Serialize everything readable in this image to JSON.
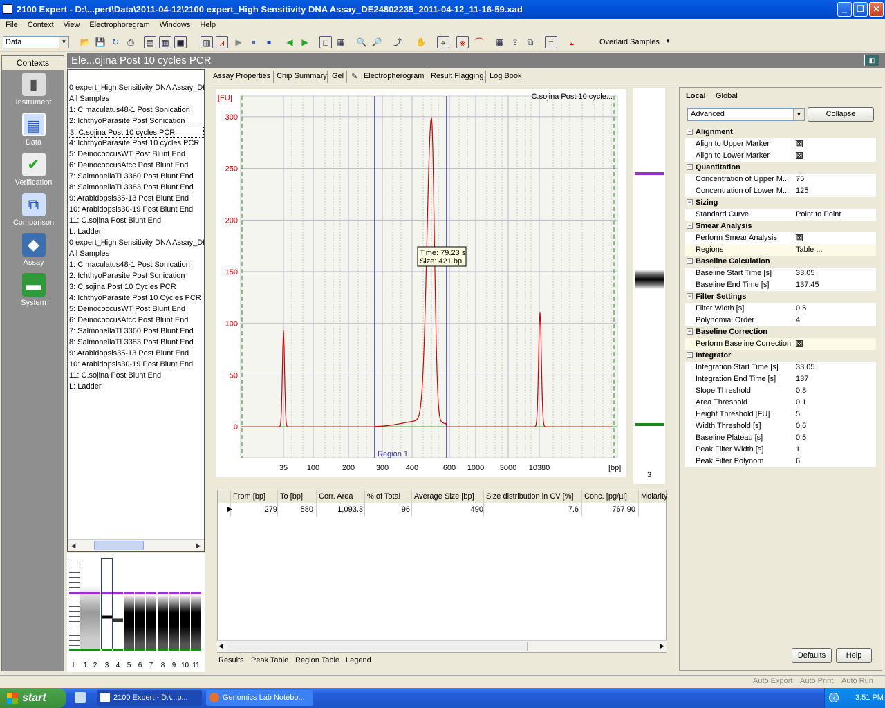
{
  "window": {
    "title": "2100 Expert - D:\\...pert\\Data\\2011-04-12\\2100 expert_High Sensitivity DNA Assay_DE24802235_2011-04-12_11-16-59.xad",
    "minimize": "_",
    "maximize": "❐",
    "close": "✕"
  },
  "menu": [
    "File",
    "Context",
    "View",
    "Electrophoregram",
    "Windows",
    "Help"
  ],
  "toolbar": {
    "context_select": "Data",
    "overlaid_select": "Overlaid Samples"
  },
  "contexts": {
    "header": "Contexts",
    "items": [
      {
        "label": "Instrument",
        "icon": "instrument-icon"
      },
      {
        "label": "Data",
        "icon": "data-icon"
      },
      {
        "label": "Verification",
        "icon": "verification-icon"
      },
      {
        "label": "Comparison",
        "icon": "comparison-icon"
      },
      {
        "label": "Assay",
        "icon": "assay-icon"
      },
      {
        "label": "System",
        "icon": "system-icon"
      }
    ]
  },
  "page_title": "Ele...ojina Post 10 cycles PCR",
  "sample_list": [
    "0 expert_High Sensitivity DNA Assay_DE",
    "All Samples",
    "1: C.maculatus48-1 Post Sonication",
    "2: IchthyoParasite Post Sonication",
    "3: C.sojina Post 10 cycles PCR",
    "4: IchthyoParasite Post 10 cycles PCR",
    "5: DeinococcusWT Post Blunt End",
    "6: DeinococcusAtcc Post Blunt End",
    "7: SalmonellaTL3360 Post Blunt End",
    "8: SalmonellaTL3383 Post Blunt End",
    "9: Arabidopsis35-13 Post Blunt End",
    "10: Arabidopsis30-19 Post Blunt End",
    "11: C.sojina Post Blunt End",
    "L: Ladder",
    "0 expert_High Sensitivity DNA Assay_DE",
    "All Samples",
    "1: C.maculatus48-1 Post Sonication",
    "2: IchthyoParasite Post Sonication",
    "3: C.sojina Post 10 Cycles PCR",
    "4: IchthyoParasite Post 10 Cycles PCR",
    "5: DeinococcusWT Post Blunt End",
    "6: DeinococcusAtcc Post Blunt End",
    "7: SalmonellaTL3360 Post Blunt End",
    "8: SalmonellaTL3383 Post Blunt End",
    "9: Arabidopsis35-13 Post Blunt End",
    "10: Arabidopsis30-19 Post Blunt End",
    "11: C.sojina Post Blunt End",
    "L: Ladder"
  ],
  "gel_lanes": [
    "L",
    "1",
    "2",
    "3",
    "4",
    "5",
    "6",
    "7",
    "8",
    "9",
    "10",
    "11"
  ],
  "tabs": [
    "Assay Properties",
    "Chip Summary",
    "Gel",
    "Electropherogram",
    "Result Flagging",
    "Log Book"
  ],
  "chart_data": {
    "type": "line",
    "title": "C.sojina Post 10 cycle...",
    "ylabel": "[FU]",
    "xlabel": "[bp]",
    "ylim": [
      -30,
      320
    ],
    "yticks": [
      0,
      50,
      100,
      150,
      200,
      250,
      300
    ],
    "xticks": [
      "35",
      "100",
      "200",
      "300",
      "400",
      "600",
      "1000",
      "3000",
      "10380"
    ],
    "series": [
      {
        "color": "#d00000",
        "peaks": [
          {
            "size_bp": 35,
            "fu": 93
          },
          {
            "size_bp": 421,
            "fu": 294
          },
          {
            "size_bp": 10380,
            "fu": 111
          }
        ]
      }
    ],
    "region_label": "Region 1",
    "tooltip": {
      "time": "Time: 79.23 s",
      "size": "Size: 421 bp"
    }
  },
  "gel_lane_number": "3",
  "results_table": {
    "columns": [
      "From [bp]",
      "To [bp]",
      "Corr. Area",
      "% of Total",
      "Average Size [bp]",
      "Size distribution in CV [%]",
      "Conc. [pg/µl]",
      "Molarity"
    ],
    "rows": [
      [
        "279",
        "580",
        "1,093.3",
        "96",
        "490",
        "7.6",
        "767.90",
        ""
      ]
    ]
  },
  "bottom_tabs": [
    "Results",
    "Peak Table",
    "Region Table",
    "Legend"
  ],
  "right_panel": {
    "tabs": [
      "Local",
      "Global"
    ],
    "mode_select": "Advanced",
    "collapse_button": "Collapse",
    "sections": [
      {
        "title": "Alignment",
        "rows": [
          [
            "Align to Upper Marker",
            "☒"
          ],
          [
            "Align to Lower Marker",
            "☒"
          ]
        ]
      },
      {
        "title": "Quantitation",
        "rows": [
          [
            "Concentration of Upper M...",
            "75"
          ],
          [
            "Concentration of Lower M...",
            "125"
          ]
        ]
      },
      {
        "title": "Sizing",
        "rows": [
          [
            "Standard Curve",
            "Point to Point"
          ]
        ]
      },
      {
        "title": "Smear Analysis",
        "rows": [
          [
            "Perform Smear Analysis",
            "☒"
          ],
          [
            "Regions",
            "Table ..."
          ]
        ]
      },
      {
        "title": "Baseline Calculation",
        "rows": [
          [
            "Baseline Start Time [s]",
            "33.05"
          ],
          [
            "Baseline End Time [s]",
            "137.45"
          ]
        ]
      },
      {
        "title": "Filter Settings",
        "rows": [
          [
            "Filter Width [s]",
            "0.5"
          ],
          [
            "Polynomial Order",
            "4"
          ]
        ]
      },
      {
        "title": "Baseline Correction",
        "rows": [
          [
            "Perform Baseline Correction",
            "☒"
          ]
        ]
      },
      {
        "title": "Integrator",
        "rows": [
          [
            "Integration Start Time [s]",
            "33.05"
          ],
          [
            "Integration End Time [s]",
            "137"
          ],
          [
            "Slope Threshold",
            "0.8"
          ],
          [
            "Area Threshold",
            "0.1"
          ],
          [
            "Height Threshold [FU]",
            "5"
          ],
          [
            "Width Threshold [s]",
            "0.6"
          ],
          [
            "Baseline Plateau [s]",
            "0.5"
          ],
          [
            "Peak Filter Width [s]",
            "1"
          ],
          [
            "Peak Filter Polynom",
            "6"
          ]
        ]
      }
    ],
    "defaults_button": "Defaults",
    "help_button": "Help"
  },
  "statusbar": [
    "Auto Export",
    "Auto Print",
    "Auto Run"
  ],
  "taskbar": {
    "start": "start",
    "tasks": [
      "2100 Expert - D:\\...p...",
      "Genomics Lab Notebo..."
    ],
    "clock": "3:51 PM"
  }
}
